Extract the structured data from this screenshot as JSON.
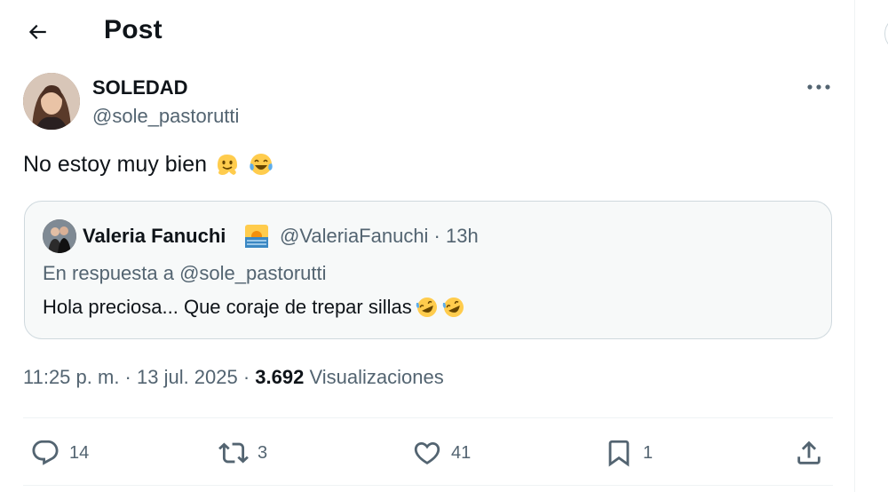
{
  "header": {
    "title": "Post"
  },
  "post": {
    "author_name": "SOLEDAD",
    "author_handle": "@sole_pastorutti",
    "text": "No estoy muy bien",
    "emojis": [
      "melting-face-emoji",
      "face-with-tears-of-joy-emoji"
    ]
  },
  "quote": {
    "author_name": "Valeria Fanuchi",
    "author_badge": "sunrise-emoji",
    "meta": "@ValeriaFanuchi · 13h",
    "reply_to": "En respuesta a @sole_pastorutti",
    "text": "Hola preciosa... Que coraje de trepar sillas",
    "emojis": [
      "rolling-on-floor-laughing-emoji",
      "rolling-on-floor-laughing-emoji"
    ]
  },
  "stats": {
    "time_date": "11:25 p. m. · 13 jul. 2025 · ",
    "views_count": "3.692",
    "views_label": "Visualizaciones"
  },
  "actions": {
    "replies": "14",
    "reposts": "3",
    "likes": "41",
    "bookmarks": "1"
  },
  "colors": {
    "text": "#0f1419",
    "secondary": "#536471",
    "border": "#cfd9de",
    "quote_bg": "#f7f9f9"
  }
}
